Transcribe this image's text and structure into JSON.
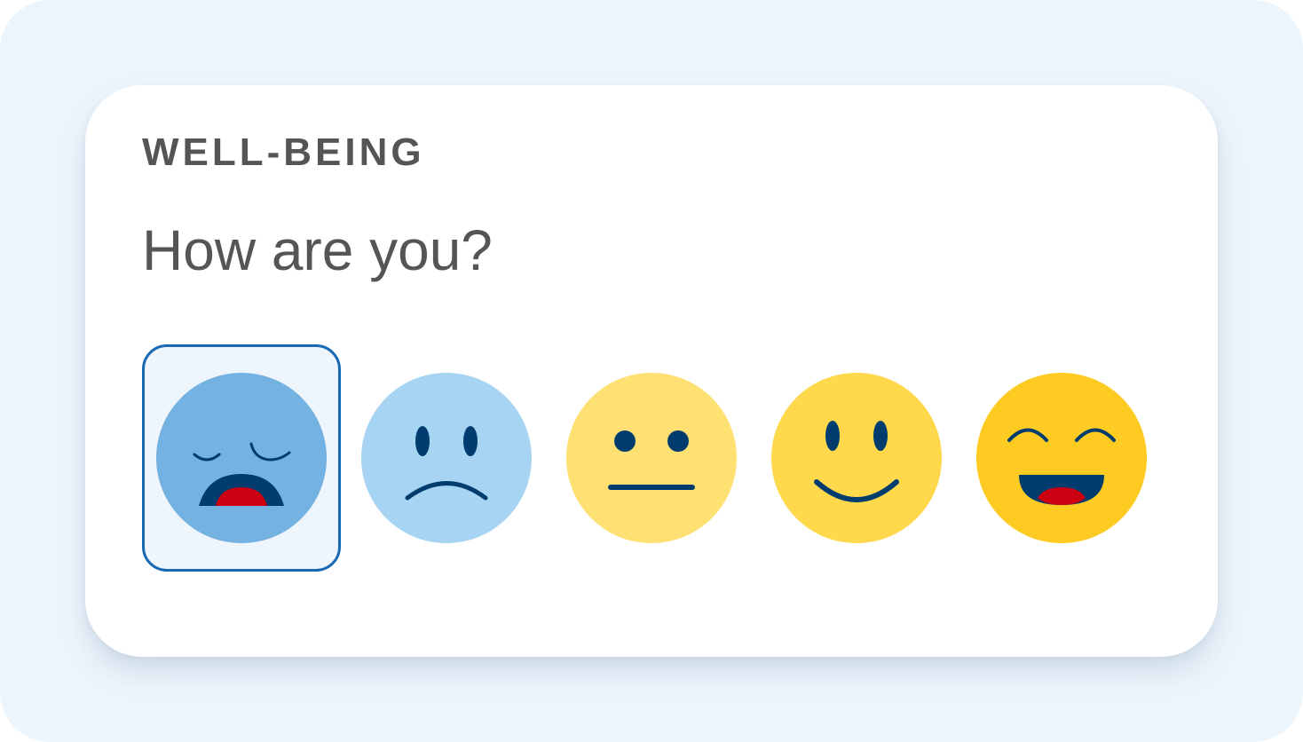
{
  "widget": {
    "section_label": "WELL-BEING",
    "question": "How are you?"
  },
  "mood_options": [
    {
      "icon": "crying-face-icon",
      "color": "#74b3e1",
      "selected": true
    },
    {
      "icon": "sad-face-icon",
      "color": "#a8d4f3",
      "selected": false
    },
    {
      "icon": "neutral-face-icon",
      "color": "#ffe173",
      "selected": false
    },
    {
      "icon": "smiling-face-icon",
      "color": "#ffd84c",
      "selected": false
    },
    {
      "icon": "laughing-face-icon",
      "color": "#fdcb22",
      "selected": false
    }
  ],
  "colors": {
    "page_background": "#edf5fc",
    "card_background": "#ffffff",
    "selected_border": "#1769b4",
    "face_ink": "#003d6e",
    "mouth_tongue": "#cc0011",
    "text": "#555555"
  }
}
